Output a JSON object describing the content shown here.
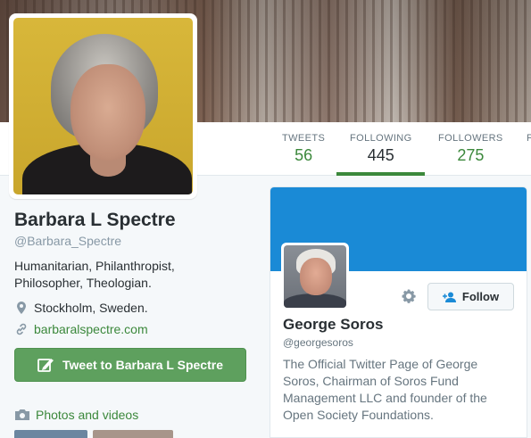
{
  "nav": {
    "tweets": {
      "label": "TWEETS",
      "value": "56"
    },
    "following": {
      "label": "FOLLOWING",
      "value": "445"
    },
    "followers": {
      "label": "FOLLOWERS",
      "value": "275"
    }
  },
  "profile": {
    "name": "Barbara L Spectre",
    "handle": "@Barbara_Spectre",
    "bio": "Humanitarian, Philanthropist, Philosopher, Theologian.",
    "location": "Stockholm, Sweden.",
    "url": "barbaralspectre.com",
    "tweet_button": "Tweet to Barbara L Spectre",
    "photos_link": "Photos and videos"
  },
  "card": {
    "name": "George Soros",
    "handle": "@georgesoros",
    "follow_label": "Follow",
    "bio": "The Official Twitter Page of George Soros, Chairman of Soros Fund Management LLC and founder of the Open Society Foundations."
  },
  "colors": {
    "accent": "#3b883b",
    "card_banner": "#1a8ad6",
    "tweet_button": "#5ea05e"
  }
}
